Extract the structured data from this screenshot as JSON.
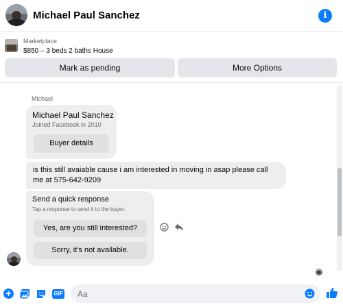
{
  "header": {
    "contact_name": "Michael Paul Sanchez",
    "info_icon": "info-icon"
  },
  "marketplace": {
    "label": "Marketplace",
    "listing": "$850 – 3 beds 2 baths House",
    "mark_pending_label": "Mark as pending",
    "more_options_label": "More Options"
  },
  "chat": {
    "sender_name": "Michael",
    "profile_card": {
      "name": "Michael Paul Sanchez",
      "joined": "Joined Facebook in 2010",
      "button_label": "Buyer details"
    },
    "message_text": "is this still avaiable cause i am interested in moving in asap please call me at 575-642-9209",
    "quick_response": {
      "title": "Send a quick response",
      "subtitle": "Tap a response to send it to the buyer.",
      "options": [
        "Yes, are you still interested?",
        "Sorry, it's not available."
      ]
    }
  },
  "composer": {
    "placeholder": "Aa",
    "gif_label": "GIF",
    "plus_label": "+"
  },
  "colors": {
    "accent": "#0a7cff",
    "bubble": "#eeeeee",
    "button": "#e4e6eb"
  }
}
